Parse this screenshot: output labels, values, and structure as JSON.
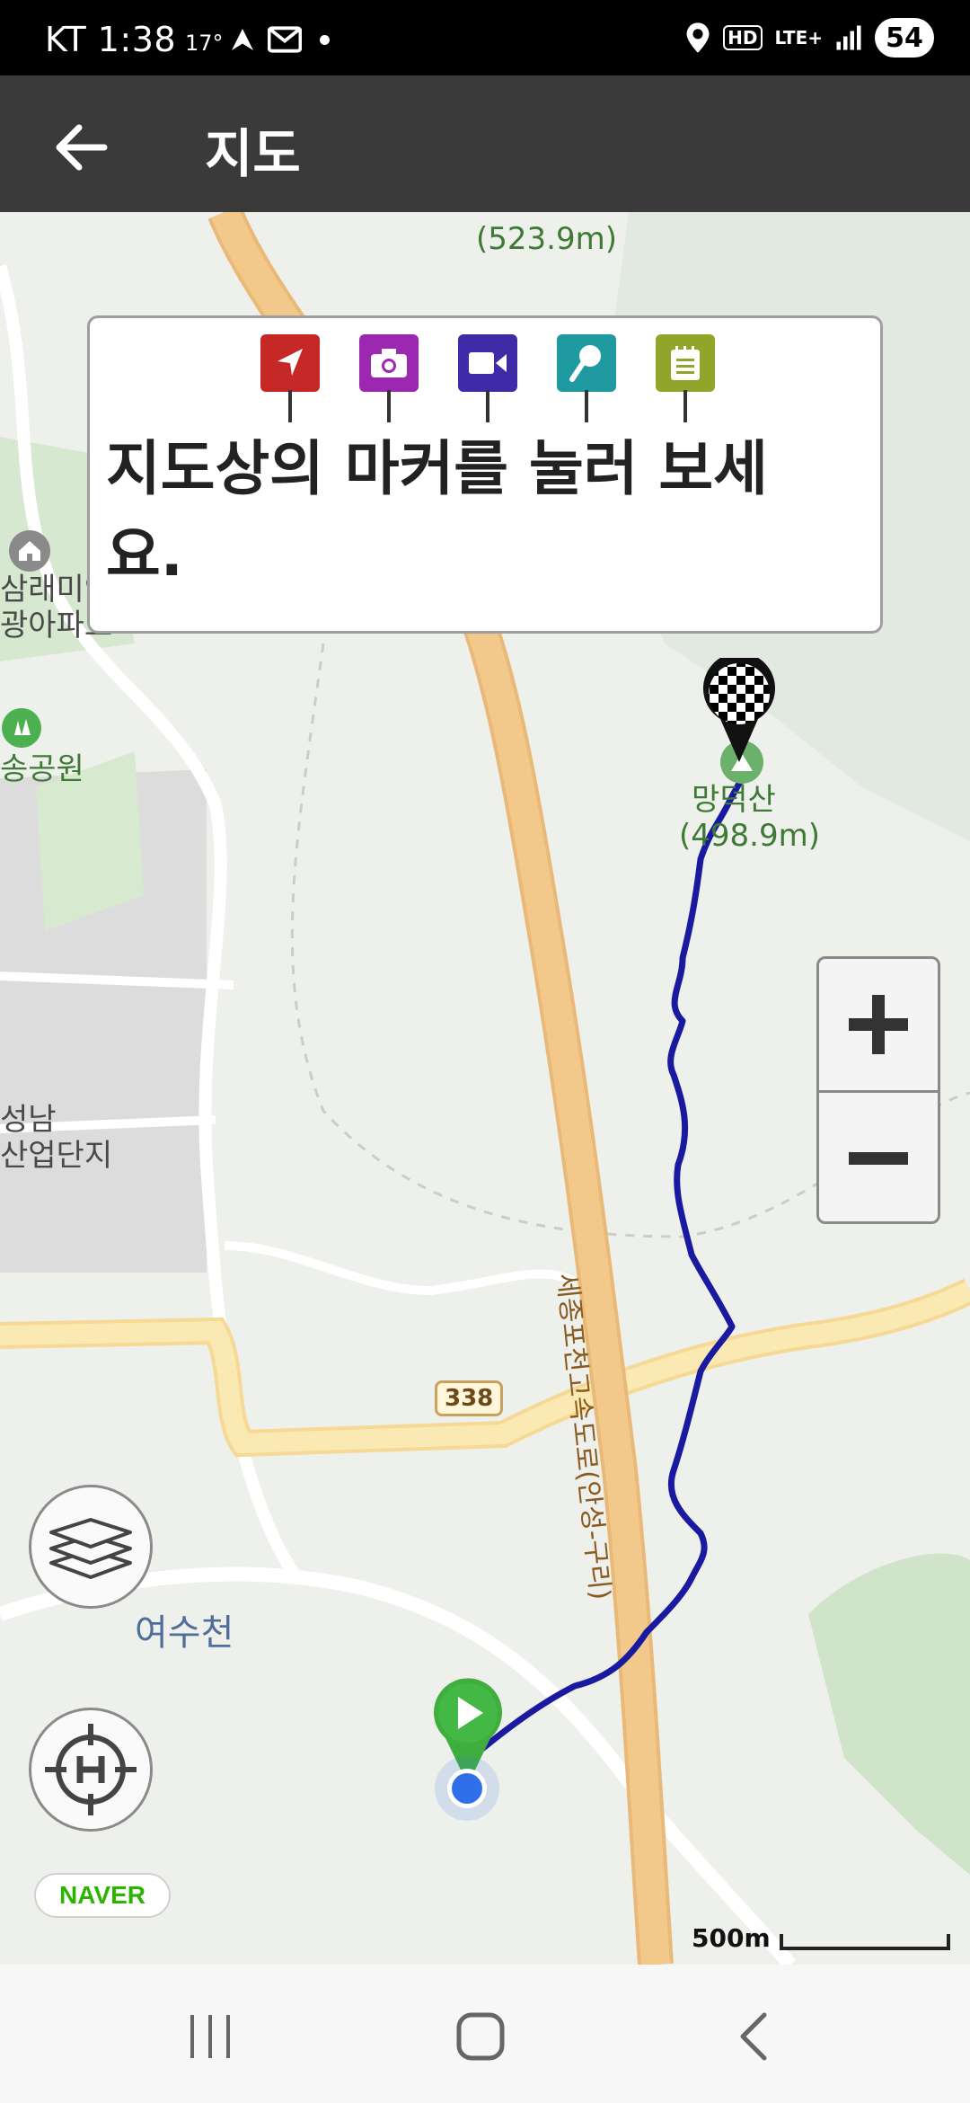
{
  "status_bar": {
    "carrier_time": "KT 1:38",
    "temperature": "17°",
    "hd_badge": "HD",
    "network": "LTE+",
    "battery": "54"
  },
  "app_bar": {
    "title": "지도",
    "back_icon": "arrow-left-icon"
  },
  "info_box": {
    "legend_markers": [
      {
        "name": "start-flag-marker",
        "color": "#c62828"
      },
      {
        "name": "camera-marker",
        "color": "#9c27b0"
      },
      {
        "name": "video-marker",
        "color": "#3f2aa8"
      },
      {
        "name": "microphone-marker",
        "color": "#1f9aa0"
      },
      {
        "name": "note-marker",
        "color": "#8fa62a"
      }
    ],
    "message": "지도상의 마커를 눌러 보세요."
  },
  "map": {
    "labels": {
      "top_peak_elevation": "(523.9m)",
      "apartment": "삼래미안\n광아파트",
      "park": "송공원",
      "summit_name": "망덕산",
      "summit_elevation": "(498.9m)",
      "industrial": "성남\n산업단지",
      "expressway": "세종포천고속도로(안성-구리)",
      "route_number": "338",
      "stream": "여수천"
    },
    "brand": "NAVER",
    "scale_label": "500m",
    "track_color": "#1a1aa0"
  },
  "colors": {
    "app_bar_bg": "#3a3a3a",
    "road_orange": "#f3c98b",
    "road_yellow": "#fbe7a6",
    "start_pin": "#3fae3f",
    "location_dot": "#2f6fe8"
  }
}
